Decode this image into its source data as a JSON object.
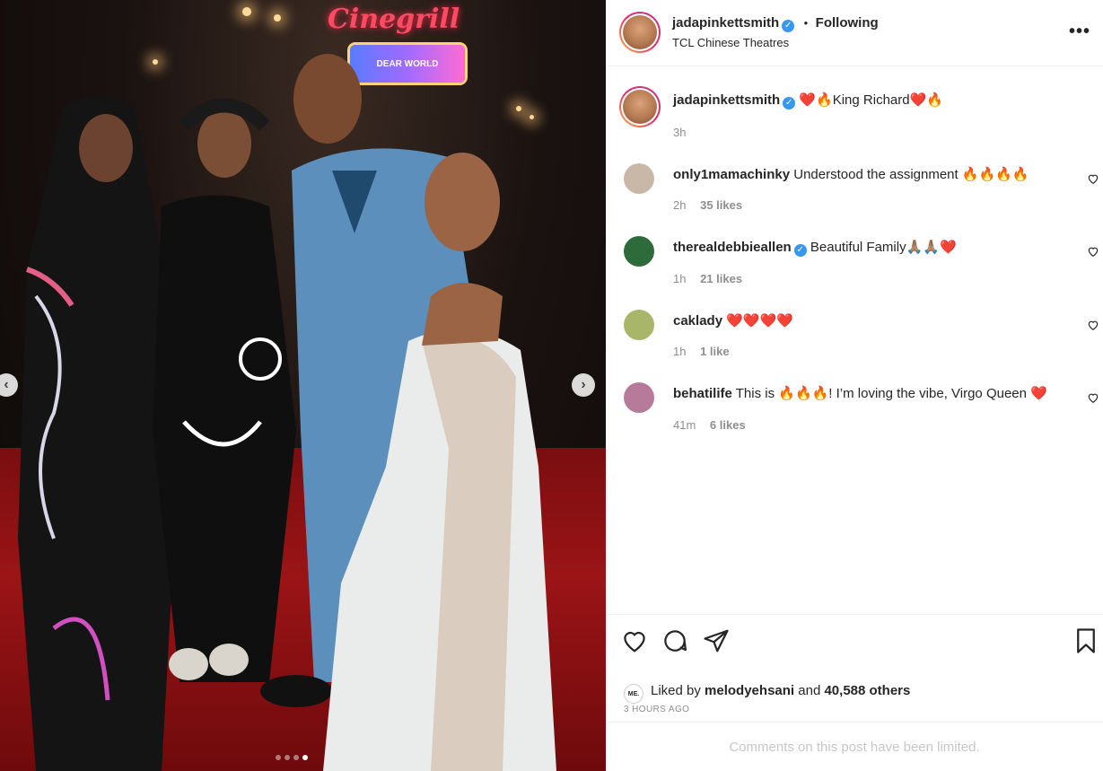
{
  "photo": {
    "sign_text": "Cinegrill",
    "marquee_text": "DEAR WORLD",
    "prev_label": "‹",
    "next_label": "›",
    "dots": [
      false,
      false,
      false,
      true
    ]
  },
  "post": {
    "author": "jadapinkettsmith",
    "separator": "•",
    "follow_status": "Following",
    "location": "TCL Chinese Theatres",
    "more_label": "•••",
    "caption": "❤️🔥King Richard❤️🔥",
    "caption_time": "3h"
  },
  "comments": [
    {
      "user": "only1mamachinky",
      "text": "Understood the assignment 🔥🔥🔥🔥",
      "time": "2h",
      "likes": "35 likes",
      "avatar_color": "#c9b8a8",
      "verified": false
    },
    {
      "user": "therealdebbieallen",
      "text": "Beautiful Family🙏🏽🙏🏽❤️",
      "time": "1h",
      "likes": "21 likes",
      "avatar_color": "#2d6b3a",
      "verified": true
    },
    {
      "user": "caklady",
      "text": "❤️❤️❤️❤️",
      "time": "1h",
      "likes": "1 like",
      "avatar_color": "#a8b66a",
      "verified": false
    },
    {
      "user": "behatilife",
      "text": "This is 🔥🔥🔥! I’m loving the vibe, Virgo Queen ❤️",
      "time": "41m",
      "likes": "6 likes",
      "avatar_color": "#b77a9a",
      "verified": false
    }
  ],
  "actions": {
    "liked_prefix": "Liked by",
    "liked_user": "melodyehsani",
    "liked_and": "and",
    "liked_count": "40,588 others",
    "me_badge": "ME.",
    "timestamp": "3 HOURS AGO",
    "limited_text": "Comments on this post have been limited."
  }
}
